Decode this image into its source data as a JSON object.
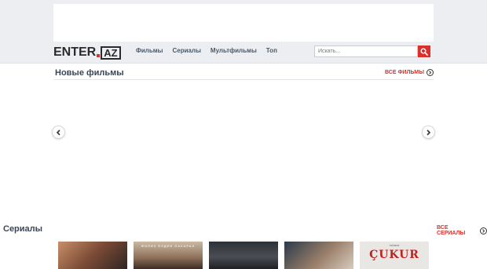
{
  "header": {
    "logo_enter": "ENTER",
    "logo_az": "AZ",
    "nav": [
      "Фильмы",
      "Сериалы",
      "Мультфильмы",
      "Топ"
    ],
    "search_placeholder": "Искать...",
    "search_icon": "magnifier-icon"
  },
  "sections": {
    "new_films": {
      "title": "Новые фильмы",
      "all_link": "ВСЕ ФИЛЬМЫ"
    },
    "series": {
      "title": "Сериалы",
      "all_link": "ВСЕ СЕРИАЛЫ"
    }
  },
  "posters": {
    "p2_caption": "ФИЛИЗ ЕЛДЕН ЛАКАРАЗ",
    "p5_caption_small": "YAĞMUR",
    "p5_caption": "ÇUKUR"
  },
  "colors": {
    "accent": "#d9302c",
    "band": "#eceef1",
    "title": "#3a4656"
  }
}
